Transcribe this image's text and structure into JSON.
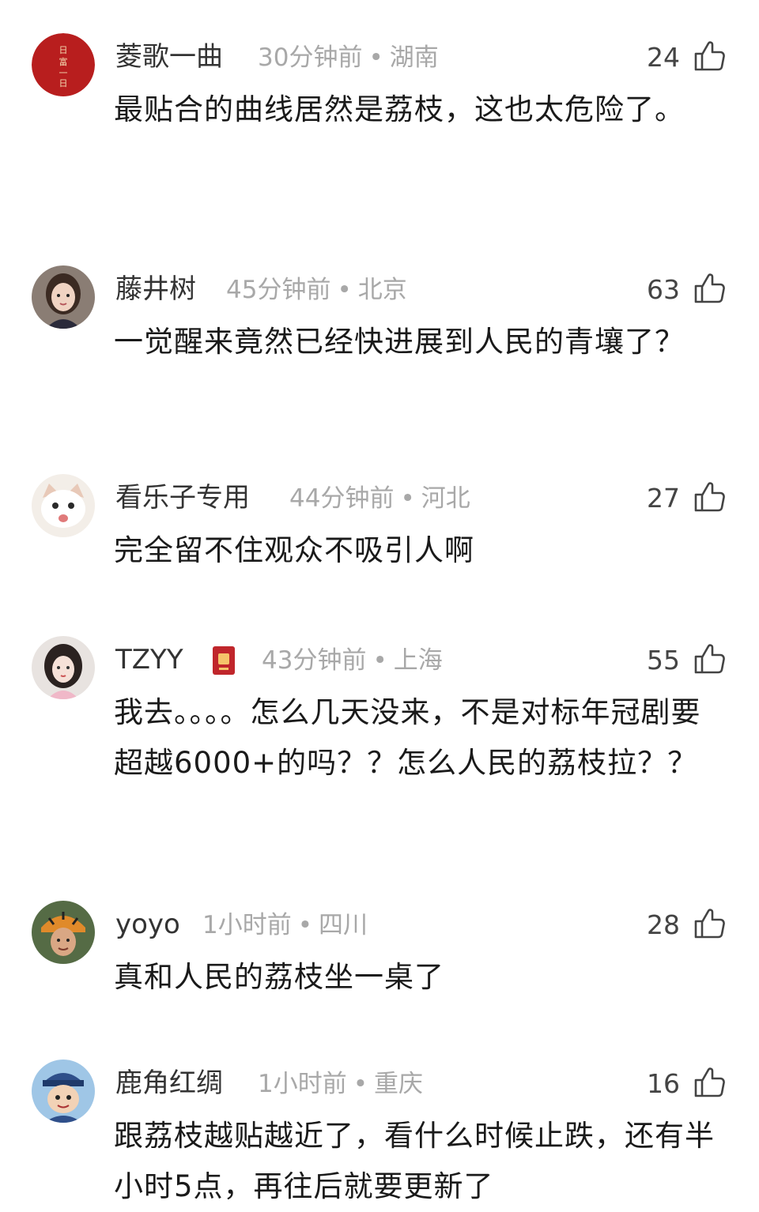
{
  "comments": [
    {
      "user": "菱歌一曲",
      "time": "30分钟前",
      "location": "湖南",
      "likes": "24",
      "text": "最贴合的曲线居然是荔枝，这也太危险了。",
      "avatar": "avatar-red-seal",
      "avatar_color": "#b81e1e"
    },
    {
      "user": "藤井树",
      "time": "45分钟前",
      "location": "北京",
      "likes": "63",
      "text": "一觉醒来竟然已经快进展到人民的青壤了？",
      "avatar": "avatar-girl-portrait",
      "avatar_color": "#7a6a60"
    },
    {
      "user": "看乐子专用",
      "time": "44分钟前",
      "location": "河北",
      "likes": "27",
      "text": "完全留不住观众不吸引人啊",
      "avatar": "avatar-cat",
      "avatar_color": "#f3eee8"
    },
    {
      "user": "TZYY",
      "time": "43分钟前",
      "location": "上海",
      "likes": "55",
      "text": "我去。。。。怎么几天没来，不是对标年冠剧要超越6000+的吗？？怎么人民的荔枝拉？？",
      "avatar": "avatar-drawn-girl",
      "avatar_color": "#e8e3e0",
      "badge": "red-badge-icon"
    },
    {
      "user": "yoyo",
      "time": "1小时前",
      "location": "四川",
      "likes": "28",
      "text": "真和人民的荔枝坐一桌了",
      "avatar": "avatar-man-tiger-hat",
      "avatar_color": "#556b45"
    },
    {
      "user": "鹿角红绸",
      "time": "1小时前",
      "location": "重庆",
      "likes": "16",
      "text": "跟荔枝越贴越近了，看什么时候止跌，还有半小时5点，再往后就要更新了",
      "avatar": "avatar-cartoon-boy",
      "avatar_color": "#9fc6e6"
    }
  ],
  "separator": "•",
  "like_icon": "thumb-up-icon"
}
